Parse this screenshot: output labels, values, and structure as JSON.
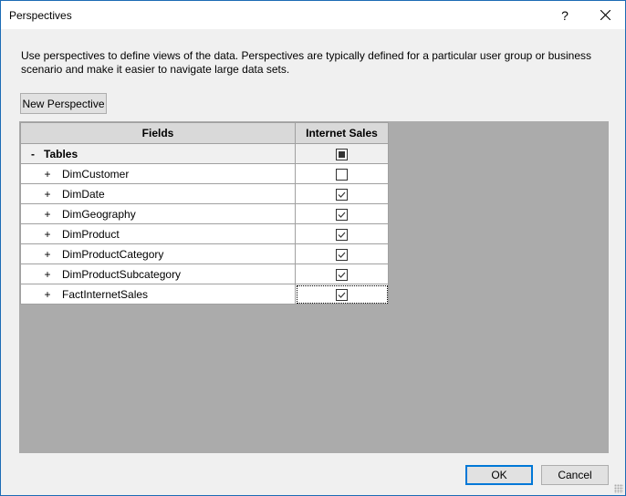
{
  "window": {
    "title": "Perspectives",
    "help_label": "?",
    "close_icon": "close-icon"
  },
  "description": "Use perspectives to define views of the data. Perspectives are typically defined for a particular user group or business scenario and make it easier to navigate large data sets.",
  "toolbar": {
    "new_perspective_label": "New Perspective"
  },
  "grid": {
    "columns": [
      "Fields",
      "Internet Sales"
    ],
    "group": {
      "expander": "-",
      "label": "Tables",
      "state": "indeterminate"
    },
    "rows": [
      {
        "expander": "+",
        "label": "DimCustomer",
        "checked": false
      },
      {
        "expander": "+",
        "label": "DimDate",
        "checked": true
      },
      {
        "expander": "+",
        "label": "DimGeography",
        "checked": true
      },
      {
        "expander": "+",
        "label": "DimProduct",
        "checked": true
      },
      {
        "expander": "+",
        "label": "DimProductCategory",
        "checked": true
      },
      {
        "expander": "+",
        "label": "DimProductSubcategory",
        "checked": true
      },
      {
        "expander": "+",
        "label": "FactInternetSales",
        "checked": true,
        "focused": true
      }
    ]
  },
  "footer": {
    "ok_label": "OK",
    "cancel_label": "Cancel"
  },
  "colors": {
    "accent": "#0078d7",
    "window_border": "#1c6bb5",
    "grid_background": "#ababab"
  }
}
